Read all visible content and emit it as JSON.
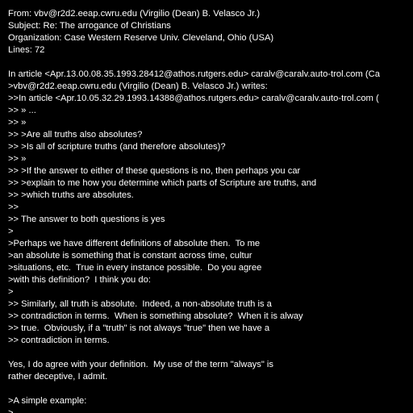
{
  "document": {
    "lines": [
      "From: vbv@r2d2.eeap.cwru.edu (Virgilio (Dean) B. Velasco Jr.)",
      "Subject: Re: The arrogance of Christians",
      "Organization: Case Western Reserve Univ. Cleveland, Ohio (USA)",
      "Lines: 72",
      "",
      "In article <Apr.13.00.08.35.1993.28412@athos.rutgers.edu> caralv@caralv.auto-trol.com (Ca",
      ">vbv@r2d2.eeap.cwru.edu (Virgilio (Dean) B. Velasco Jr.) writes:",
      ">>In article <Apr.10.05.32.29.1993.14388@athos.rutgers.edu> caralv@caralv.auto-trol.com (",
      ">> » ...",
      ">> »",
      ">> >Are all truths also absolutes?",
      ">> >Is all of scripture truths (and therefore absolutes)?",
      ">> »",
      ">> >If the answer to either of these questions is no, then perhaps you car",
      ">> >explain to me how you determine which parts of Scripture are truths, and",
      ">> >which truths are absolutes.",
      ">>",
      ">> The answer to both questions is yes",
      ">",
      ">Perhaps we have different definitions of absolute then.  To me",
      ">an absolute is something that is constant across time, cultur",
      ">situations, etc.  True in every instance possible.  Do you agree",
      ">with this definition?  I think you do:",
      ">",
      ">> Similarly, all truth is absolute.  Indeed, a non-absolute truth is a",
      ">> contradiction in terms.  When is something absolute?  When it is alway",
      ">> true.  Obviously, if a \"truth\" is not always \"true\" then we have a",
      ">> contradiction in terms.",
      "",
      "Yes, I do agree with your definition.  My use of the term \"always\" is",
      "rather deceptive, I admit.",
      "",
      ">A simple example:",
      ">"
    ]
  }
}
